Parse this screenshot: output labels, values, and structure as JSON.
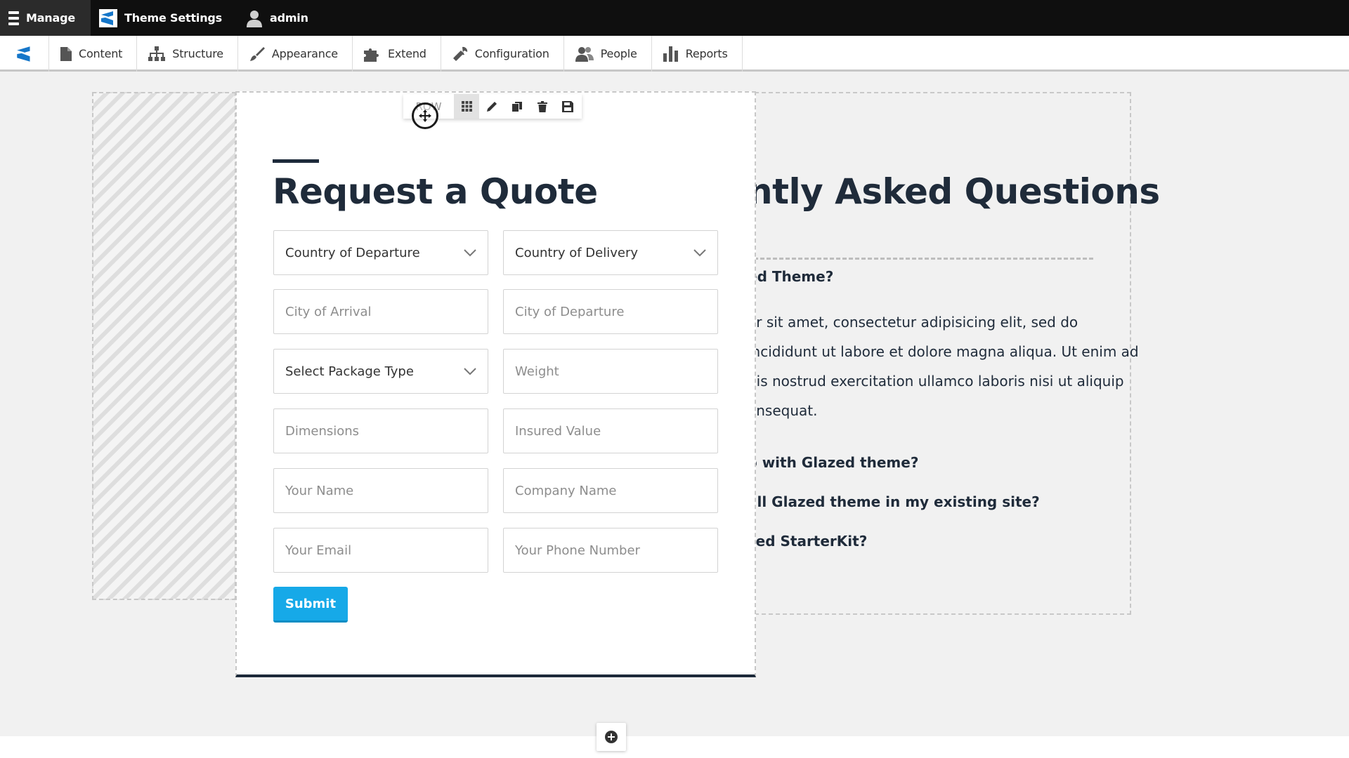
{
  "toolbar": {
    "manage_label": "Manage",
    "theme_settings_label": "Theme Settings",
    "user_label": "admin"
  },
  "tray": {
    "items": [
      {
        "label": "Content",
        "icon": "file-icon"
      },
      {
        "label": "Structure",
        "icon": "sitemap-icon"
      },
      {
        "label": "Appearance",
        "icon": "paintbrush-icon"
      },
      {
        "label": "Extend",
        "icon": "puzzle-icon"
      },
      {
        "label": "Configuration",
        "icon": "wrench-icon"
      },
      {
        "label": "People",
        "icon": "people-icon"
      },
      {
        "label": "Reports",
        "icon": "bar-chart-icon"
      }
    ]
  },
  "row_toolbar": {
    "label": "ROW"
  },
  "form": {
    "title": "Request a Quote",
    "country_departure": "Country of Departure",
    "country_delivery": "Country of Delivery",
    "city_arrival": "City of Arrival",
    "city_departure": "City of Departure",
    "package_type": "Select Package Type",
    "weight": "Weight",
    "dimensions": "Dimensions",
    "insured_value": "Insured Value",
    "your_name": "Your Name",
    "company_name": "Company Name",
    "your_email": "Your Email",
    "phone": "Your Phone Number",
    "submit_label": "Submit"
  },
  "faq": {
    "title": "ntly Asked Questions",
    "q1": "ed Theme?",
    "a1_line1": "or sit amet, consectetur adipisicing elit, sed do",
    "a1_line2": "incididunt ut labore et dolore magna aliqua. Ut enim ad",
    "a1_line3": "uis nostrud exercitation ullamco laboris nisi ut aliquip",
    "a1_line4": "onsequat.",
    "q2": "o with Glazed theme?",
    "q3": "all Glazed theme in my existing site?",
    "q4": "zed StarterKit?"
  },
  "colors": {
    "primary_button": "#16a9e8",
    "heading": "#1f2b3a",
    "toolbar_bg": "#0f0f0f"
  }
}
